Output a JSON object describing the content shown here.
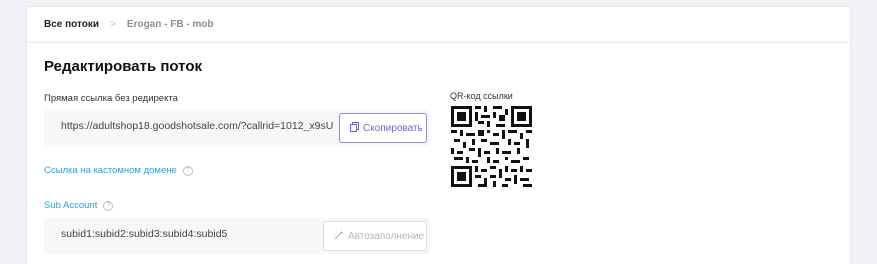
{
  "breadcrumb": {
    "root": "Все потоки",
    "separator": ">",
    "current": "Erogan - FB - mob"
  },
  "page": {
    "title": "Редактировать поток"
  },
  "direct_link": {
    "label": "Прямая ссылка без редиректа",
    "value": "https://adultshop18.goodshotsale.com/?callrid=1012_x9sU",
    "copy_label": "Скопировать",
    "copy_icon": "copy-icon"
  },
  "custom_domain": {
    "label": "Ссылка на кастомном домене",
    "help": "?"
  },
  "sub_account": {
    "label": "Sub Account",
    "help": "?",
    "value": "subid1:subid2:subid3:subid4:subid5",
    "autofill_label": "Автозаполнение",
    "autofill_icon": "magic-wand-icon"
  },
  "qr": {
    "label": "QR-код ссылки"
  },
  "colors": {
    "accent_purple": "#7a5fc8",
    "link_blue": "#29a3d6",
    "background": "#f1f2f6"
  }
}
